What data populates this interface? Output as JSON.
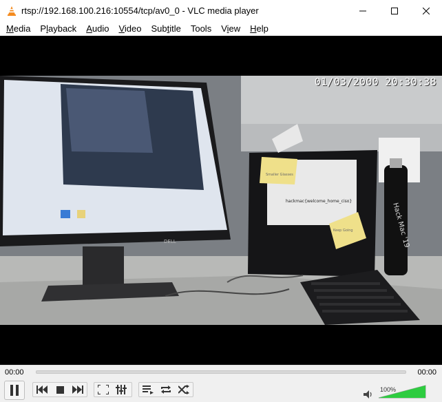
{
  "window": {
    "title": "rtsp://192.168.100.216:10554/tcp/av0_0 - VLC media player",
    "icons": [
      "vlc-cone-icon",
      "minimize-icon",
      "maximize-icon",
      "close-icon"
    ]
  },
  "menu": {
    "items": [
      {
        "label": "Media",
        "accel": "M"
      },
      {
        "label": "Playback",
        "accel": "l"
      },
      {
        "label": "Audio",
        "accel": "A"
      },
      {
        "label": "Video",
        "accel": "V"
      },
      {
        "label": "Subtitle",
        "accel": "t"
      },
      {
        "label": "Tools",
        "accel": "S"
      },
      {
        "label": "View",
        "accel": "i"
      },
      {
        "label": "Help",
        "accel": "H"
      }
    ]
  },
  "video": {
    "osd_timestamp": "01/03/2000 20:30:38",
    "note_label": "hackmac{welcome_home_ciso}",
    "bottle_text": "Hack Mac '19",
    "monitor_brand": "DELL",
    "sticky_note_1": "Smaller Glasses",
    "sticky_note_2": "Keep Going"
  },
  "controls": {
    "elapsed": "00:00",
    "total": "00:00",
    "progress": 0,
    "volume_label": "100%",
    "volume_level": 1.0,
    "accent": "#1e90ff",
    "volume_fill": "#2ecc40"
  }
}
